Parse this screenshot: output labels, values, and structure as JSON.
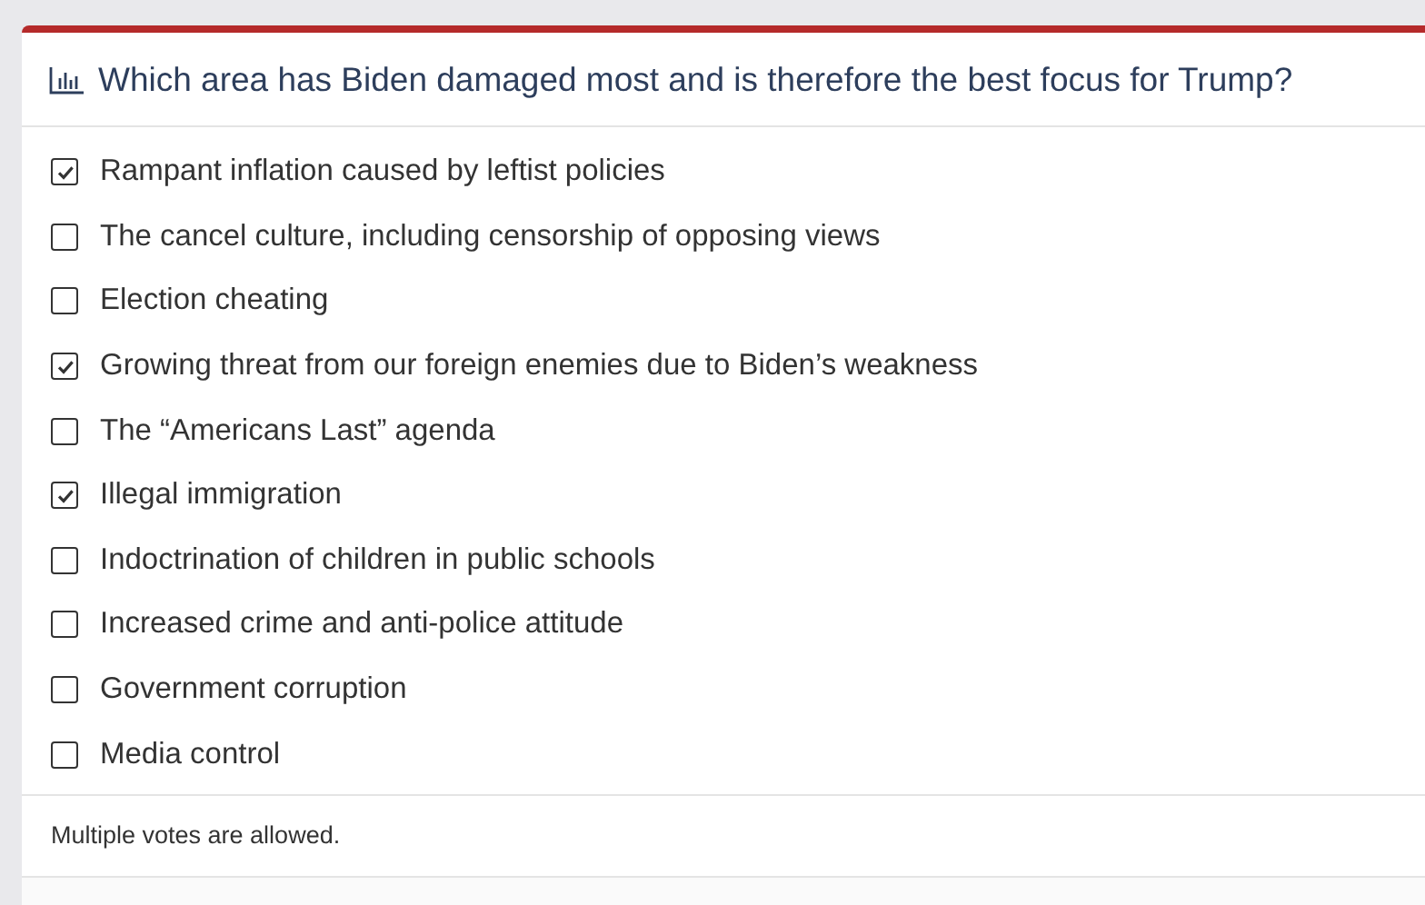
{
  "poll": {
    "title": "Which area has Biden damaged most and is therefore the best focus for Trump?",
    "options": [
      {
        "label": "Rampant inflation caused by leftist policies",
        "checked": true
      },
      {
        "label": "The cancel culture, including censorship of opposing views",
        "checked": false
      },
      {
        "label": "Election cheating",
        "checked": false
      },
      {
        "label": "Growing threat from our foreign enemies due to Biden’s weakness",
        "checked": true
      },
      {
        "label": "The “Americans Last” agenda",
        "checked": false
      },
      {
        "label": "Illegal immigration",
        "checked": true
      },
      {
        "label": "Indoctrination of children in public schools",
        "checked": false
      },
      {
        "label": "Increased crime and anti-police attitude",
        "checked": false
      },
      {
        "label": "Government corruption",
        "checked": false
      },
      {
        "label": "Media control",
        "checked": false
      }
    ],
    "note": "Multiple votes are allowed."
  }
}
